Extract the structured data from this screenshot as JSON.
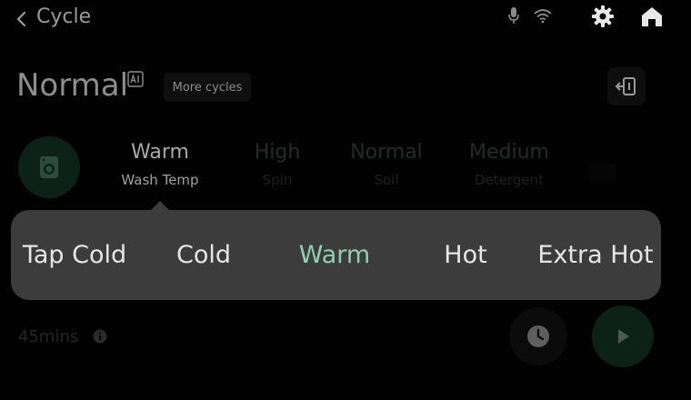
{
  "header": {
    "title": "Cycle"
  },
  "cycle": {
    "name": "Normal",
    "more_label": "More cycles"
  },
  "options": {
    "wash_temp": {
      "value": "Warm",
      "label": "Wash Temp"
    },
    "spin": {
      "value": "High",
      "label": "Spin"
    },
    "soil": {
      "value": "Normal",
      "label": "Soil"
    },
    "detergent": {
      "value": "Medium",
      "label": "Detergent"
    }
  },
  "selector": {
    "items": [
      "Tap Cold",
      "Cold",
      "Warm",
      "Hot",
      "Extra Hot"
    ],
    "selected": "Warm"
  },
  "footer": {
    "duration": "45mins"
  },
  "icons": [
    "back-icon",
    "mic-icon",
    "wifi-icon",
    "gear-icon",
    "home-icon",
    "ai-icon",
    "exit-icon",
    "washer-icon",
    "info-icon",
    "clock-icon",
    "play-icon"
  ],
  "colors": {
    "accent": "#8fcfb2",
    "panel": "#3c3c3c",
    "green_button": "#0c2218"
  }
}
